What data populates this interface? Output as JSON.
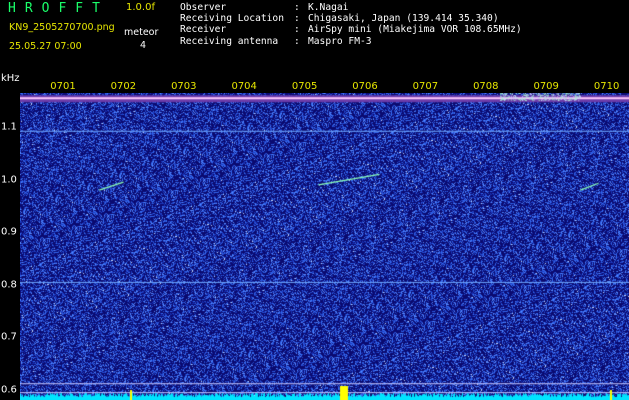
{
  "header": {
    "brand": "HROFFT",
    "version": "1.0.0f",
    "filename": "KN9_2505270700.png",
    "datetime": "25.05.27 07:00",
    "meteor_label": "meteor",
    "meteor_count": "4",
    "info": [
      {
        "key": "Observer",
        "sep": ":",
        "value": "K.Nagai"
      },
      {
        "key": "Receiving Location",
        "sep": ":",
        "value": "Chigasaki, Japan (139.414 35.340)"
      },
      {
        "key": "Receiver",
        "sep": ":",
        "value": "AirSpy mini (Miakejima VOR 108.65MHz)"
      },
      {
        "key": "Receiving antenna",
        "sep": ":",
        "value": "Maspro FM-3"
      }
    ]
  },
  "chart_data": {
    "type": "heatmap",
    "ylabel": "kHz",
    "x_ticks": [
      "0701",
      "0702",
      "0703",
      "0704",
      "0705",
      "0706",
      "0707",
      "0708",
      "0709",
      "0710"
    ],
    "y_ticks": [
      "1.1",
      "1.0",
      "0.9",
      "0.8",
      "0.7",
      "0.6"
    ],
    "ylim": [
      0.58,
      1.165
    ],
    "background_color": "#0a0a70",
    "noise_color": "#2f5cff",
    "carrier_color": "#ffc8ff",
    "baseline_color": "#00e5ff",
    "marker_color": "#ffff00",
    "carrier_line_khz": 1.155,
    "horizontal_lines_khz": [
      1.093,
      0.805,
      0.612
    ],
    "meteors": [
      {
        "t_start": 0.13,
        "t_end": 0.17,
        "f_start": 0.98,
        "f_end": 0.995
      },
      {
        "t_start": 0.49,
        "t_end": 0.59,
        "f_start": 0.99,
        "f_end": 1.01
      },
      {
        "t_start": 0.92,
        "t_end": 0.95,
        "f_start": 0.98,
        "f_end": 0.993
      }
    ]
  }
}
